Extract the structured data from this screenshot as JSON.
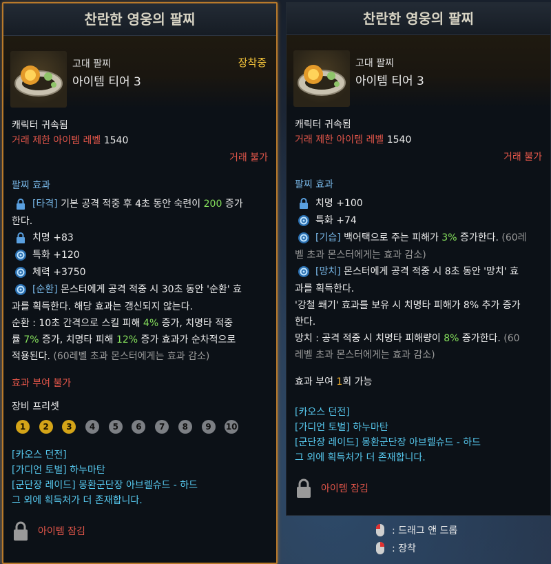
{
  "left": {
    "title": "찬란한 영웅의 팔찌",
    "grade": "고대 팔찌",
    "tier": "아이템 티어 3",
    "equipped": "장착중",
    "bound": "캐릭터 귀속됨",
    "trade_limit_label": "거래 제한 아이템 레벨",
    "trade_limit_value": "1540",
    "trade_status": "거래 불가",
    "effect_title": "팔찌 효과",
    "effect1_a": "[타격]",
    "effect1_b": " 기본 공격 적중 후 4초 동안 숙련이 ",
    "effect1_c": "200",
    "effect1_d": " 증가",
    "effect1_line2": "한다.",
    "stat1": "치명 +83",
    "stat2": "특화 +120",
    "stat3": "체력 +3750",
    "effect2_a": "[순환]",
    "effect2_b": " 몬스터에게 공격 적중 시 30초 동안 '순환' 효",
    "effect2_line2": "과를 획득한다. 해당 효과는 갱신되지 않는다.",
    "effect2_line3_a": "순환 : 10초 간격으로 스킬 피해 ",
    "effect2_line3_b": "4%",
    "effect2_line3_c": " 증가, 치명타 적중",
    "effect2_line4_a": "률 ",
    "effect2_line4_b": "7%",
    "effect2_line4_c": " 증가, 치명타 피해 ",
    "effect2_line4_d": "12%",
    "effect2_line4_e": " 증가 효과가 순차적으로",
    "effect2_line5_a": "적용된다.",
    "effect2_line5_b": " (60레벨 초과 몬스터에게는 효과 감소)",
    "no_effect": "효과 부여 불가",
    "preset_title": "장비 프리셋",
    "presets": [
      "1",
      "2",
      "3",
      "4",
      "5",
      "6",
      "7",
      "8",
      "9",
      "10"
    ],
    "source1": "[카오스 던전]",
    "source2": "[가디언 토벌] 하누마탄",
    "source3": "[군단장 레이드] 몽환군단장 아브렐슈드 - 하드",
    "source4": "그 외에 획득처가 더 존재합니다.",
    "lock_label": "아이템 잠김"
  },
  "right": {
    "title": "찬란한 영웅의 팔찌",
    "grade": "고대 팔찌",
    "tier": "아이템 티어 3",
    "bound": "캐릭터 귀속됨",
    "trade_limit_label": "거래 제한 아이템 레벨",
    "trade_limit_value": "1540",
    "trade_status": "거래 불가",
    "effect_title": "팔찌 효과",
    "stat1": "치명 +100",
    "stat2": "특화 +74",
    "effect1_a": "[기습]",
    "effect1_b": " 백어택으로 주는 피해가 ",
    "effect1_c": "3%",
    "effect1_d": " 증가한다.",
    "effect1_e": " (60레",
    "effect1_line2": "벨 초과 몬스터에게는 효과 감소)",
    "effect2_a": "[망치]",
    "effect2_b": " 몬스터에게 공격 적중 시 8초 동안 '망치' 효",
    "effect2_line2": "과를 획득한다.",
    "effect2_line3": "'강철 쐐기' 효과를 보유 시 치명타 피해가 8% 추가 증가",
    "effect2_line4": "한다.",
    "effect2_line5_a": "망치 : 공격 적중 시 치명타 피해량이 ",
    "effect2_line5_b": "8%",
    "effect2_line5_c": " 증가한다.",
    "effect2_line5_d": " (60",
    "effect2_line6": "레벨 초과 몬스터에게는 효과 감소)",
    "apply_a": "효과 부여 ",
    "apply_b": "1",
    "apply_c": "회 가능",
    "source1": "[카오스 던전]",
    "source2": "[가디언 토벌] 하누마탄",
    "source3": "[군단장 레이드] 몽환군단장 아브렐슈드 - 하드",
    "source4": "그 외에 획득처가 더 존재합니다.",
    "lock_label": "아이템 잠김"
  },
  "hints": {
    "drag": ": 드래그 앤 드롭",
    "equip": ": 장착"
  }
}
